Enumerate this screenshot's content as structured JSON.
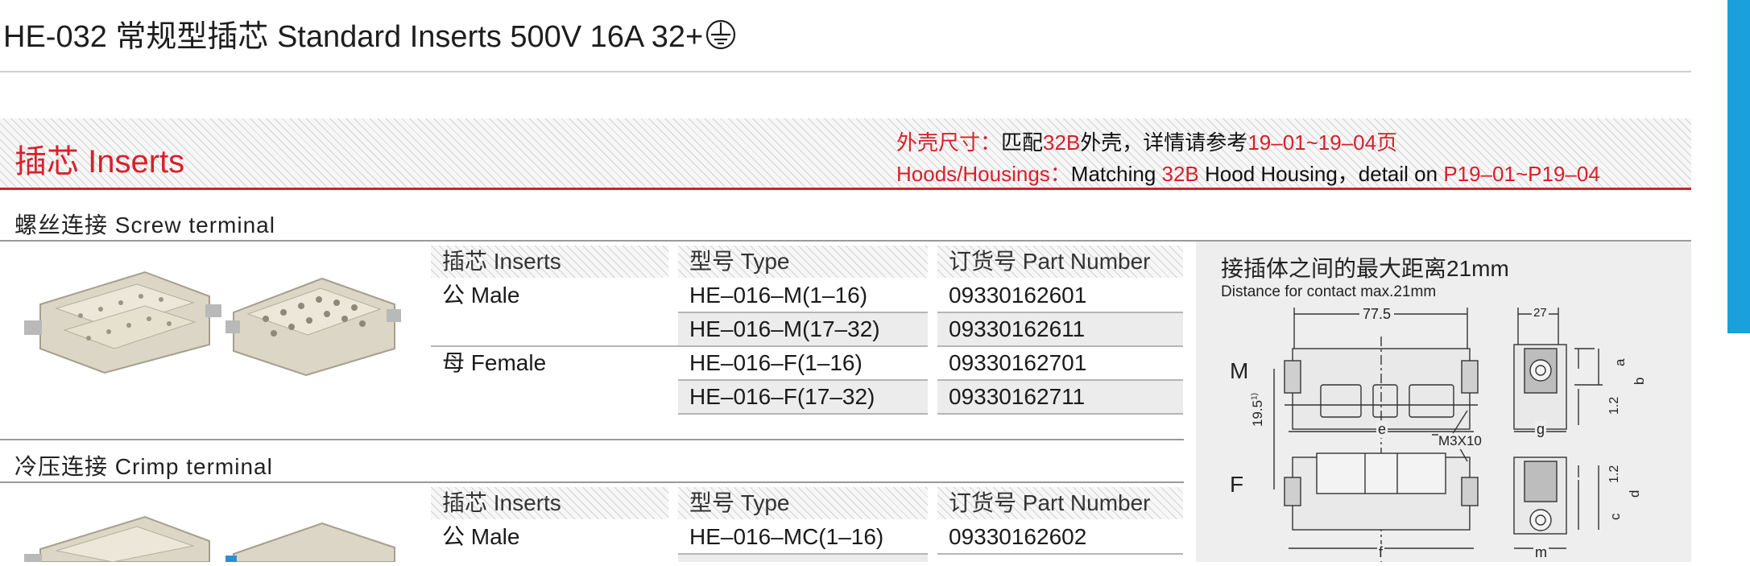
{
  "header": {
    "title": "HE-032 常规型插芯 Standard Inserts   500V 16A 32+"
  },
  "inserts_section": {
    "title": "插芯 Inserts",
    "hood_cn": [
      "外壳尺寸：",
      "匹配",
      "32B",
      "外壳，详情请参考",
      "19–01~19–04页"
    ],
    "hood_en": [
      "Hoods/Housings：",
      "Matching ",
      "32B",
      " Hood Housing，detail on ",
      "P19–01~P19–04"
    ]
  },
  "screw": {
    "label": "螺丝连接 Screw terminal",
    "headers": [
      "插芯 Inserts",
      "型号 Type",
      "订货号 Part Number"
    ],
    "rows": [
      {
        "insert": "公 Male",
        "type": "HE–016–M(1–16)",
        "part": "09330162601"
      },
      {
        "insert": "",
        "type": "HE–016–M(17–32)",
        "part": "09330162611"
      },
      {
        "insert": "母 Female",
        "type": "HE–016–F(1–16)",
        "part": "09330162701"
      },
      {
        "insert": "",
        "type": "HE–016–F(17–32)",
        "part": "09330162711"
      }
    ]
  },
  "crimp": {
    "label": "冷压连接 Crimp terminal",
    "headers": [
      "插芯 Inserts",
      "型号 Type",
      "订货号 Part Number"
    ],
    "rows": [
      {
        "insert": "公 Male",
        "type": "HE–016–MC(1–16)",
        "part": "09330162602"
      }
    ]
  },
  "diagram": {
    "distance_cn": "接插体之间的最大距离21mm",
    "distance_en": "Distance for contact max.21mm",
    "label_m": "M",
    "label_f": "F",
    "dim_width": "77.5",
    "dim_27": "27",
    "dim_195": "19.5",
    "dim_195_sup": "1)",
    "dim_e": "e",
    "dim_g": "g",
    "dim_a": "a",
    "dim_b": "b",
    "dim_c": "c",
    "dim_d": "d",
    "dim_12a": "1.2",
    "dim_12b": "1.2",
    "screw_note": "M3X10",
    "dim_f": "f",
    "dim_m": "m"
  },
  "colors": {
    "accent_red": "#d8202a",
    "tab_blue": "#1aa0dc"
  }
}
